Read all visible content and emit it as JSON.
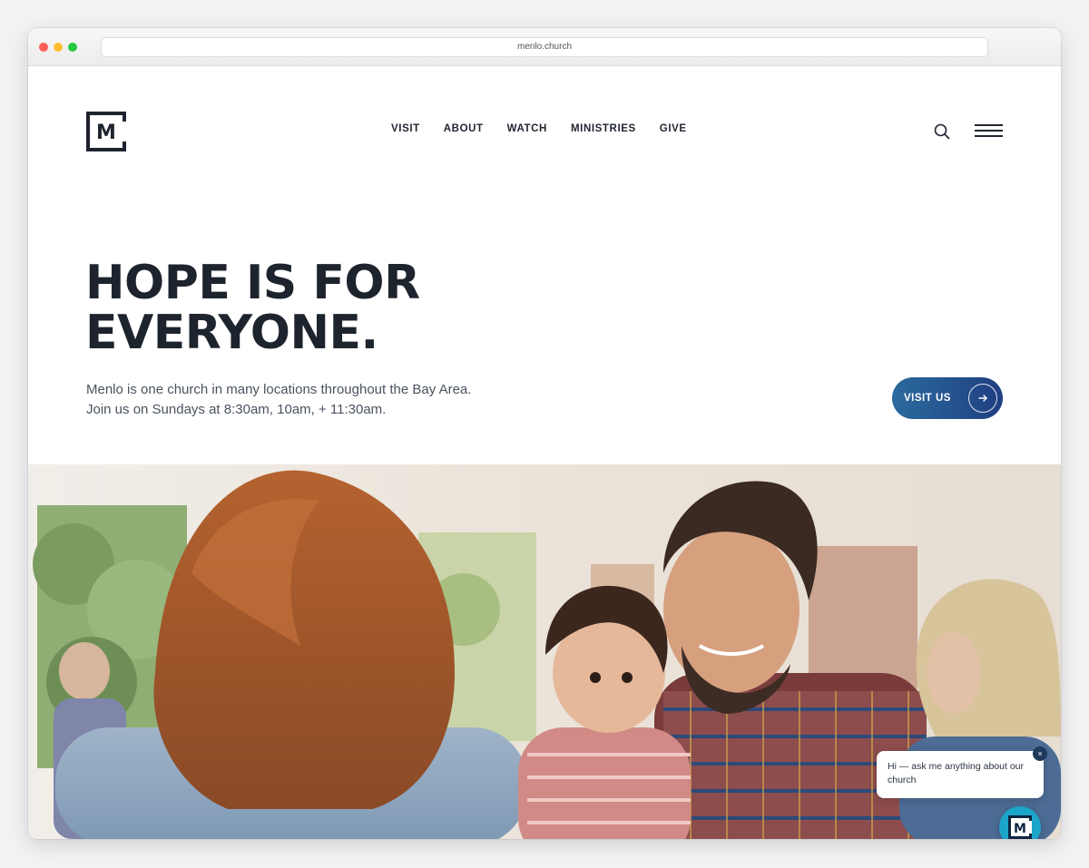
{
  "browser": {
    "url": "menlo.church"
  },
  "brand": {
    "logo_letter": "M",
    "accent": "#1f3f82",
    "text_color": "#1e242d"
  },
  "nav": {
    "items": [
      {
        "label": "VISIT"
      },
      {
        "label": "ABOUT"
      },
      {
        "label": "WATCH"
      },
      {
        "label": "MINISTRIES"
      },
      {
        "label": "GIVE"
      }
    ],
    "search_icon": "search-icon",
    "menu_icon": "hamburger-menu-icon"
  },
  "hero": {
    "headline_line1": "HOPE IS FOR",
    "headline_line2": "EVERYONE.",
    "subtext_line1": "Menlo is one church in many locations throughout the Bay Area.",
    "subtext_line2": "Join us on Sundays at 8:30am, 10am, + 11:30am.",
    "cta_label": "VISIT US",
    "cta_icon": "arrow-right-icon"
  },
  "chat": {
    "message": "Hi — ask me anything about our church",
    "close_label": "×",
    "launcher_letter": "M"
  }
}
